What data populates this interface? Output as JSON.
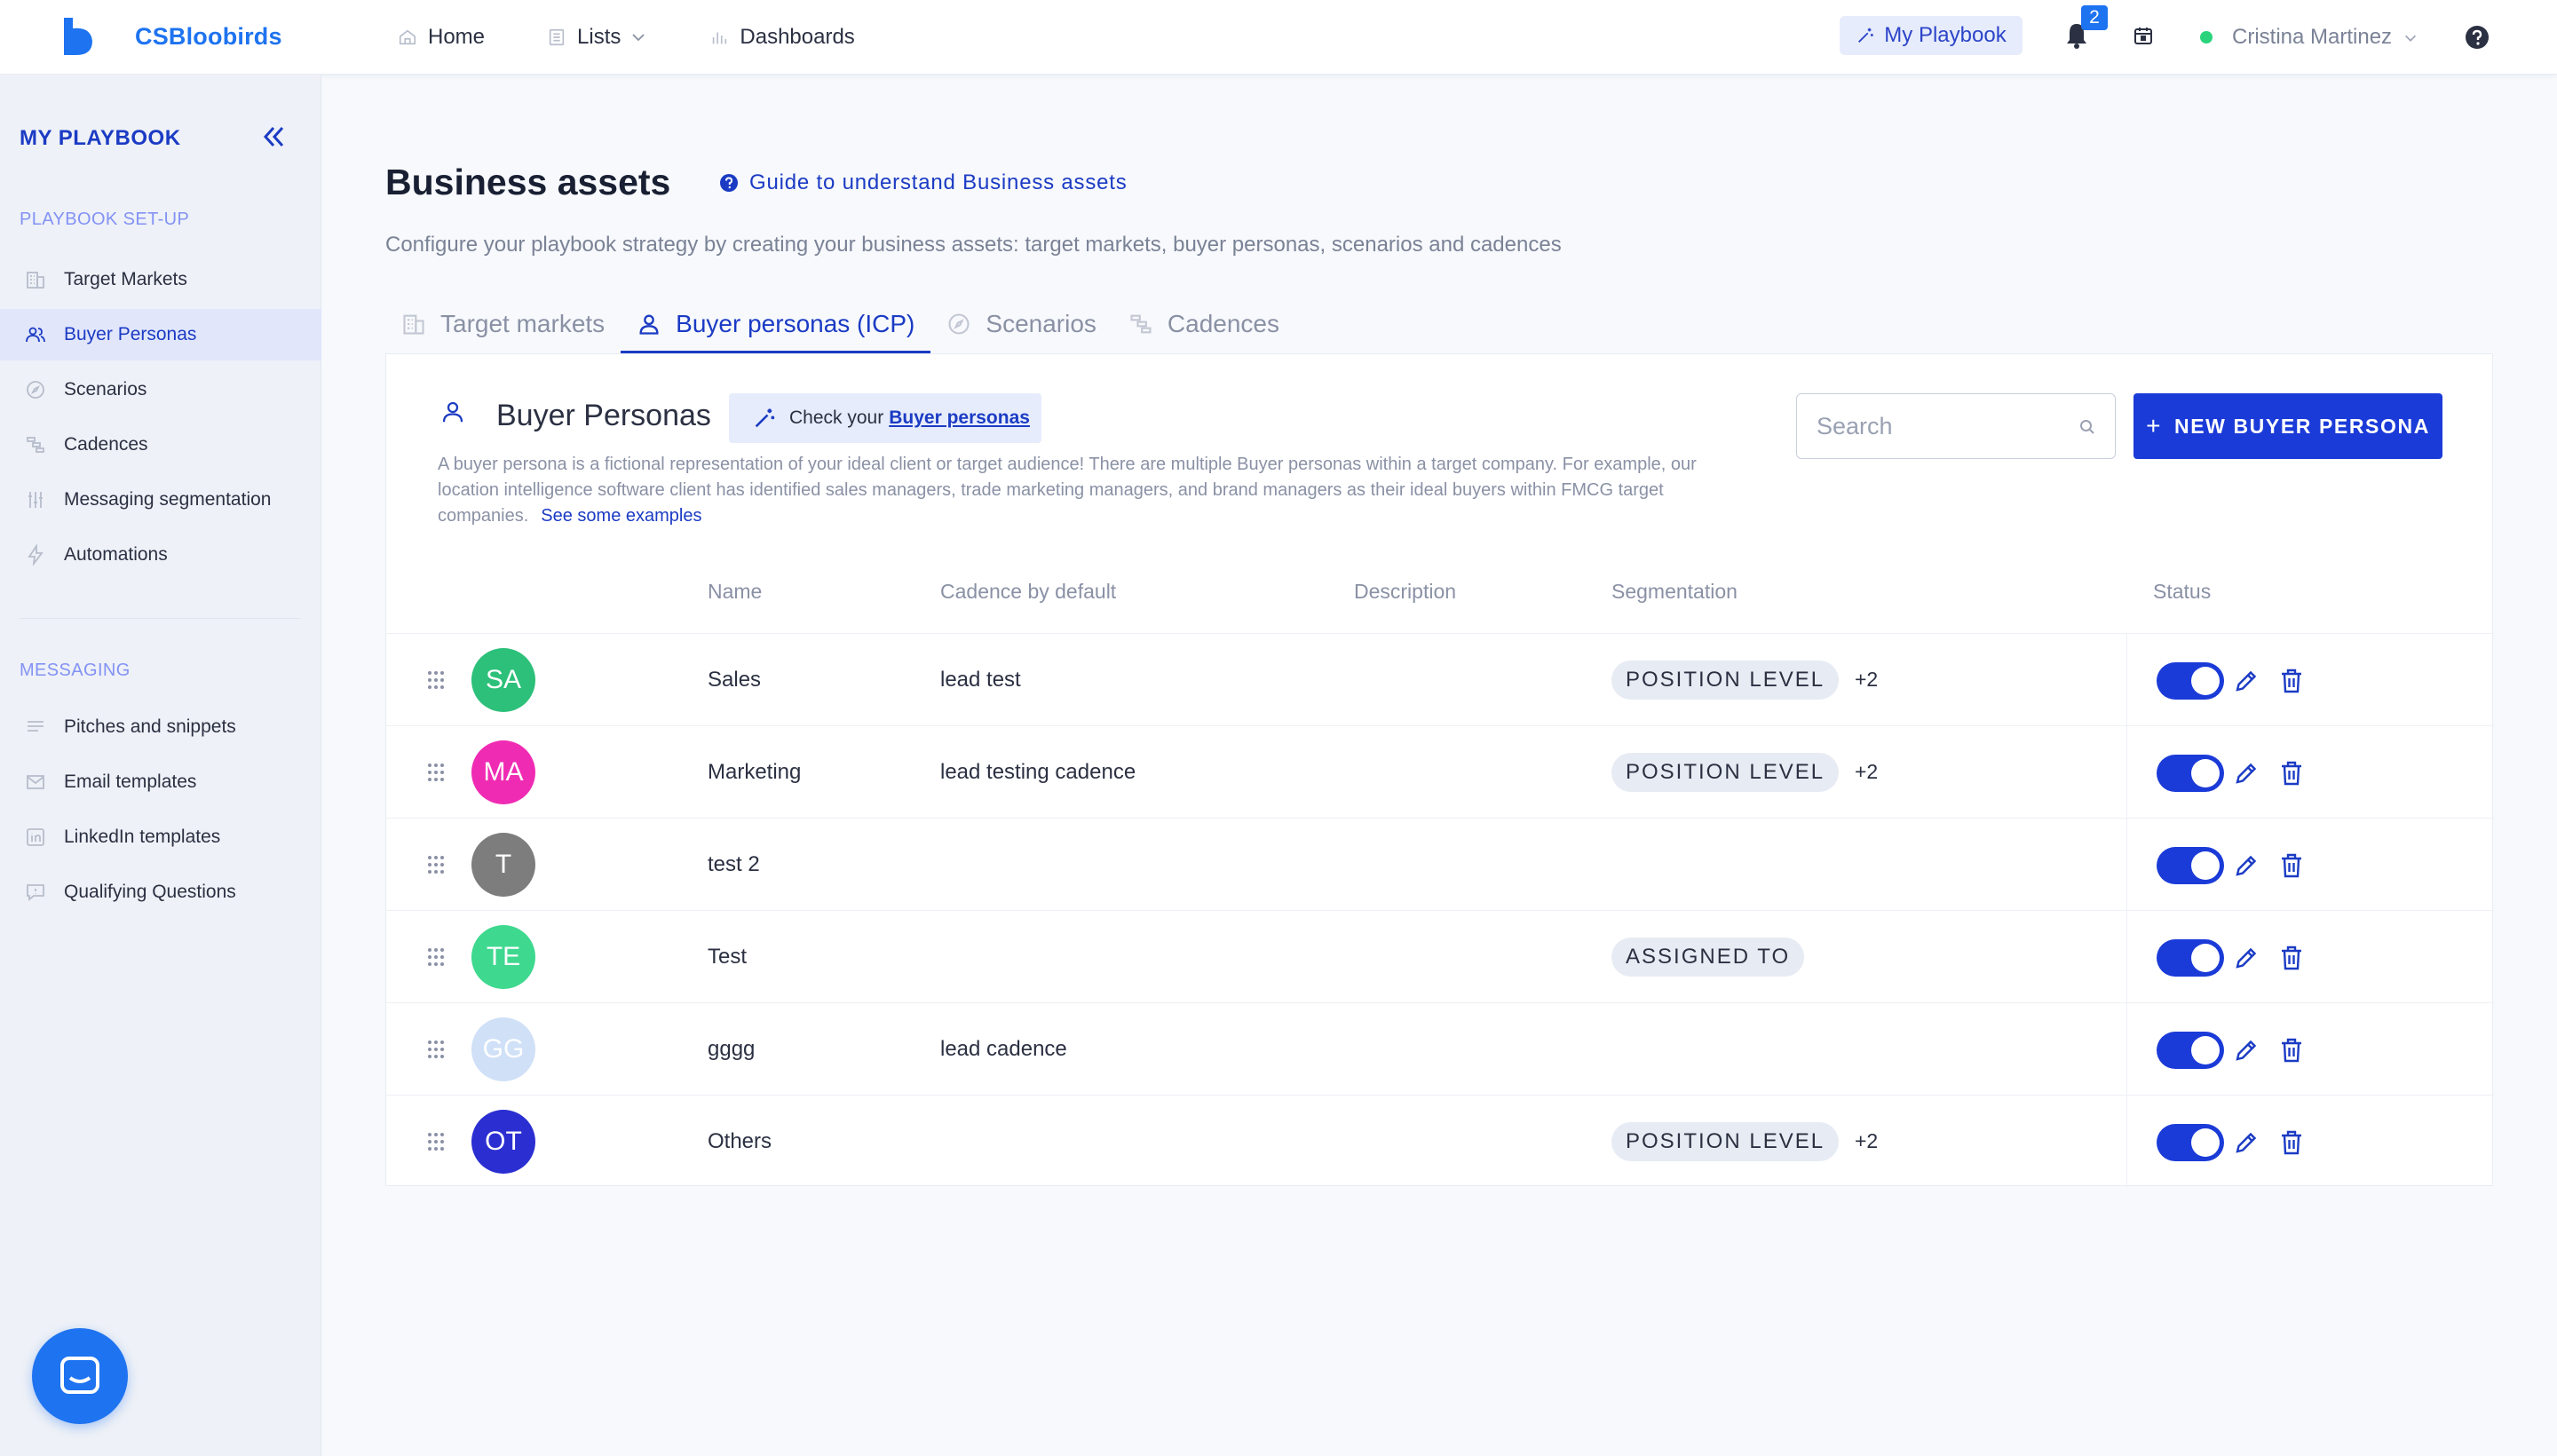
{
  "colors": {
    "brand": "#1e73f0",
    "accent": "#1b3bd8",
    "sidebar_bg": "#eef1f7",
    "online": "#2bd47c"
  },
  "topbar": {
    "brand_name": "CSBloobirds",
    "nav": [
      {
        "label": "Home",
        "icon": "home-icon"
      },
      {
        "label": "Lists",
        "icon": "list-icon"
      },
      {
        "label": "Dashboards",
        "icon": "chart-icon"
      }
    ],
    "playbook_label": "My Playbook",
    "notification_count": "2",
    "user_name": "Cristina Martinez"
  },
  "sidebar": {
    "title": "MY PLAYBOOK",
    "section_setup": "PLAYBOOK SET-UP",
    "setup_items": [
      {
        "label": "Target Markets",
        "icon": "building-icon"
      },
      {
        "label": "Buyer Personas",
        "icon": "user-group-icon",
        "active": true
      },
      {
        "label": "Scenarios",
        "icon": "compass-icon"
      },
      {
        "label": "Cadences",
        "icon": "cadence-icon"
      },
      {
        "label": "Messaging segmentation",
        "icon": "sliders-icon"
      },
      {
        "label": "Automations",
        "icon": "lightning-icon"
      }
    ],
    "section_messaging": "MESSAGING",
    "messaging_items": [
      {
        "label": "Pitches and snippets",
        "icon": "lines-icon"
      },
      {
        "label": "Email templates",
        "icon": "mail-icon"
      },
      {
        "label": "LinkedIn templates",
        "icon": "linkedin-icon"
      },
      {
        "label": "Qualifying Questions",
        "icon": "chat-icon"
      }
    ]
  },
  "main": {
    "title": "Business assets",
    "guide_link": "Guide to understand Business assets",
    "subtitle": "Configure your playbook strategy by creating your business assets: target markets, buyer personas, scenarios and cadences",
    "tabs": [
      {
        "label": "Target markets",
        "icon": "building-icon"
      },
      {
        "label": "Buyer personas (ICP)",
        "icon": "user-icon",
        "active": true
      },
      {
        "label": "Scenarios",
        "icon": "compass-icon"
      },
      {
        "label": "Cadences",
        "icon": "cadence-icon"
      }
    ]
  },
  "card": {
    "title": "Buyer Personas",
    "check_prefix": "Check your",
    "check_link": "Buyer personas",
    "description": "A buyer persona is a fictional representation of your ideal client or target audience! There are multiple Buyer personas within a target company. For example, our location intelligence software client has identified sales managers, trade marketing managers, and brand managers as their ideal buyers within FMCG target companies.",
    "examples_link": "See some examples",
    "search_placeholder": "Search",
    "new_button": "NEW BUYER PERSONA",
    "columns": {
      "name": "Name",
      "cadence": "Cadence by default",
      "description": "Description",
      "segmentation": "Segmentation",
      "status": "Status"
    },
    "rows": [
      {
        "initials": "SA",
        "color": "#2cc07a",
        "name": "Sales",
        "cadence": "lead test",
        "segmentation": "POSITION LEVEL",
        "more": "+2",
        "enabled": true
      },
      {
        "initials": "MA",
        "color": "#f02bb3",
        "name": "Marketing",
        "cadence": "lead testing cadence",
        "segmentation": "POSITION LEVEL",
        "more": "+2",
        "enabled": true
      },
      {
        "initials": "T",
        "color": "#7d7d7d",
        "name": "test 2",
        "cadence": "",
        "segmentation": "",
        "more": "",
        "enabled": true
      },
      {
        "initials": "TE",
        "color": "#3ed88f",
        "name": "Test",
        "cadence": "",
        "segmentation": "ASSIGNED TO",
        "more": "",
        "enabled": true
      },
      {
        "initials": "GG",
        "color": "#cfe0f7",
        "name": "gggg",
        "cadence": "lead cadence",
        "segmentation": "",
        "more": "",
        "enabled": true
      },
      {
        "initials": "OT",
        "color": "#2b2fd1",
        "name": "Others",
        "cadence": "",
        "segmentation": "POSITION LEVEL",
        "more": "+2",
        "enabled": true
      }
    ]
  }
}
